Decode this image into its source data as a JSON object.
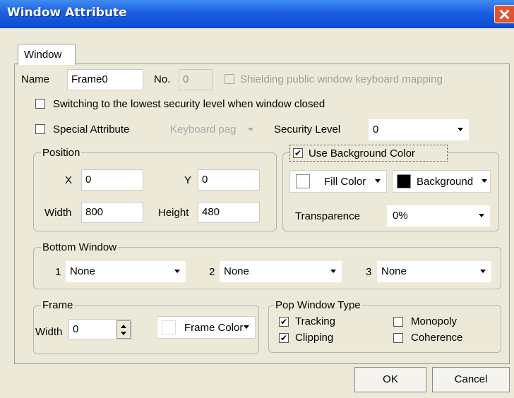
{
  "window": {
    "title": "Window Attribute"
  },
  "tabs": [
    {
      "label": "Window"
    }
  ],
  "general": {
    "name_label": "Name",
    "name_value": "Frame0",
    "no_label": "No.",
    "no_value": "0",
    "shielding_label": "Shielding public window keyboard mapping",
    "shielding_checked": false,
    "switching_label": "Switching to the lowest security level when window closed",
    "switching_checked": false,
    "special_label": "Special Attribute",
    "special_checked": false,
    "keyboard_value": "Keyboard pag",
    "security_label": "Security Level",
    "security_value": "0"
  },
  "position": {
    "legend": "Position",
    "x_label": "X",
    "x_value": "0",
    "y_label": "Y",
    "y_value": "0",
    "width_label": "Width",
    "width_value": "800",
    "height_label": "Height",
    "height_value": "480"
  },
  "background": {
    "use_label": "Use Background Color",
    "use_checked": true,
    "fill_color_label": "Fill Color",
    "fill_color": "#ffffff",
    "background_label": "Background",
    "background_color": "#000000",
    "transparence_label": "Transparence",
    "transparence_value": "0%"
  },
  "bottom_window": {
    "legend": "Bottom Window",
    "slots": [
      {
        "num": "1",
        "value": "None"
      },
      {
        "num": "2",
        "value": "None"
      },
      {
        "num": "3",
        "value": "None"
      }
    ]
  },
  "frame": {
    "legend": "Frame",
    "width_label": "Width",
    "width_value": "0",
    "color_label": "Frame Color",
    "color": "#ffffff"
  },
  "pop_window": {
    "legend": "Pop Window Type",
    "tracking_label": "Tracking",
    "tracking_checked": true,
    "clipping_label": "Clipping",
    "clipping_checked": true,
    "monopoly_label": "Monopoly",
    "monopoly_checked": false,
    "coherence_label": "Coherence",
    "coherence_checked": false
  },
  "buttons": {
    "ok": "OK",
    "cancel": "Cancel"
  }
}
